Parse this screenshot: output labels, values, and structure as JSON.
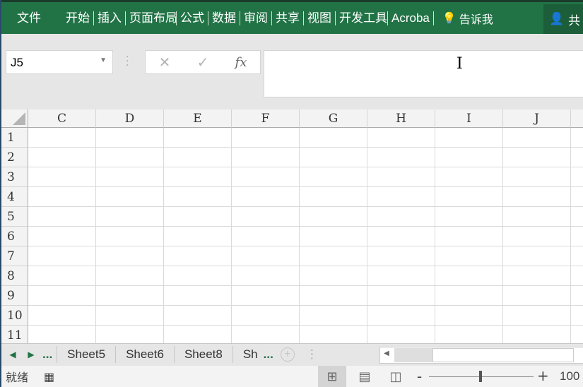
{
  "ribbon": {
    "file": "文件",
    "tabs": [
      "开始",
      "插入",
      "页面布局",
      "公式",
      "数据",
      "审阅",
      "共享",
      "视图",
      "开发工具",
      "Acroba"
    ],
    "tell": "告诉我",
    "share": "共"
  },
  "namebox": {
    "value": "J5"
  },
  "formula": {
    "fx": "fx",
    "cancel": "✕",
    "enter": "✓",
    "value": ""
  },
  "columns": [
    "C",
    "D",
    "E",
    "F",
    "G",
    "H",
    "I",
    "J"
  ],
  "rows": [
    "1",
    "2",
    "3",
    "4",
    "5",
    "6",
    "7",
    "8",
    "9",
    "10",
    "11"
  ],
  "sheets": {
    "more_left": "...",
    "tabs": [
      "Sheet5",
      "Sheet6",
      "Sheet8",
      "Sh"
    ],
    "more_right": "...",
    "add": "+"
  },
  "status": {
    "ready": "就绪",
    "zoom_minus": "-",
    "zoom_plus": "+",
    "zoom": "100"
  }
}
